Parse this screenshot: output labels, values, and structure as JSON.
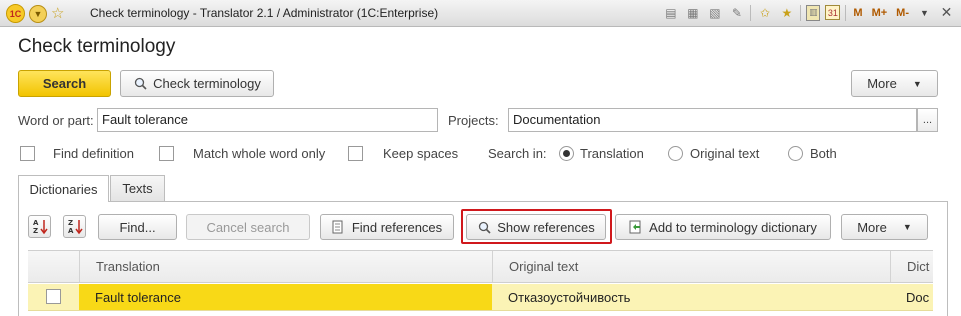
{
  "window": {
    "title": "Check terminology - Translator 2.1 / Administrator  (1C:Enterprise)",
    "logo_text": "1С",
    "toolbar_icons": [
      "save-icon",
      "print-icon",
      "print-preview-icon",
      "attachment-icon",
      "star-icon",
      "favorites-icon",
      "calculator-icon",
      "calendar-icon",
      "m-icon",
      "m-plus-icon",
      "m-minus-icon",
      "menu-dropdown-icon",
      "close-icon"
    ],
    "m_labels": [
      "M",
      "M+",
      "M-"
    ],
    "calendar_day": "31"
  },
  "page": {
    "title": "Check terminology"
  },
  "toolbar": {
    "search_label": "Search",
    "check_terminology_label": "Check terminology",
    "more_label": "More"
  },
  "form": {
    "word_label": "Word or part:",
    "word_value": "Fault tolerance",
    "projects_label": "Projects:",
    "projects_value": "Documentation",
    "ellipsis_label": "...",
    "find_definition_label": "Find definition",
    "match_whole_word_label": "Match whole word only",
    "keep_spaces_label": "Keep spaces",
    "search_in_label": "Search in:",
    "search_in_options": [
      "Translation",
      "Original text",
      "Both"
    ],
    "search_in_selected": "Translation"
  },
  "tabs": [
    {
      "label": "Dictionaries",
      "active": true
    },
    {
      "label": "Texts",
      "active": false
    }
  ],
  "panel_toolbar": {
    "find_label": "Find...",
    "cancel_search_label": "Cancel search",
    "find_references_label": "Find references",
    "show_references_label": "Show references",
    "add_to_dictionary_label": "Add to terminology dictionary",
    "more_label": "More"
  },
  "grid": {
    "columns": [
      "Translation",
      "Original text",
      "Dict"
    ],
    "rows": [
      {
        "checked": false,
        "translation": "Fault tolerance",
        "original": "Отказоустойчивость",
        "dictionary": "Doc"
      }
    ]
  },
  "colors": {
    "accent_yellow": "#f8d917",
    "row_highlight": "#fbf3b5",
    "annotation_red": "#d0181c"
  }
}
